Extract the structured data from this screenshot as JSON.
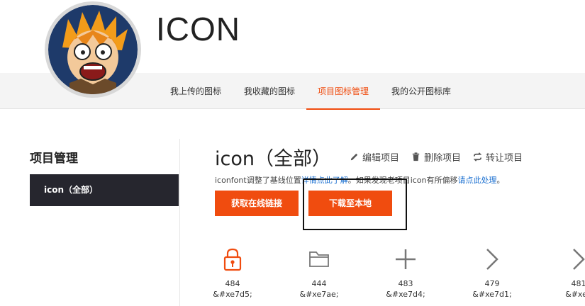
{
  "header": {
    "title": "ICON"
  },
  "tabs": [
    {
      "label": "我上传的图标"
    },
    {
      "label": "我收藏的图标"
    },
    {
      "label": "项目图标管理"
    },
    {
      "label": "我的公开图标库"
    }
  ],
  "sidebar": {
    "title": "项目管理",
    "items": [
      {
        "label": "icon（全部）"
      }
    ]
  },
  "project": {
    "title": "icon（全部）",
    "actions": [
      {
        "label": "编辑项目",
        "icon": "pencil-icon"
      },
      {
        "label": "删除项目",
        "icon": "trash-icon"
      },
      {
        "label": "转让项目",
        "icon": "transfer-icon"
      }
    ],
    "notice_prefix": "iconfont调整了基线位置",
    "notice_link1": "详情点此了解",
    "notice_middle": "。如果发现老项目icon有所偏移",
    "notice_link2": "请点此处理",
    "notice_suffix": "。",
    "link_button": "获取在线链接",
    "download_button": "下载至本地"
  },
  "icons": [
    {
      "id": "484",
      "code": "&#xe7d5;",
      "icon": "lock-icon",
      "color": "#f04c0f"
    },
    {
      "id": "444",
      "code": "&#xe7ae;",
      "icon": "folder-icon",
      "color": "#777777"
    },
    {
      "id": "483",
      "code": "&#xe7d4;",
      "icon": "plus-icon",
      "color": "#777777"
    },
    {
      "id": "479",
      "code": "&#xe7d1;",
      "icon": "chevron-right-icon",
      "color": "#777777"
    },
    {
      "id": "481",
      "code": "&#xe7",
      "icon": "chevron-right-icon",
      "color": "#777777"
    }
  ],
  "colors": {
    "accent": "#f04c0f",
    "sidebar_active": "#26262e",
    "link": "#1a6fd0"
  }
}
